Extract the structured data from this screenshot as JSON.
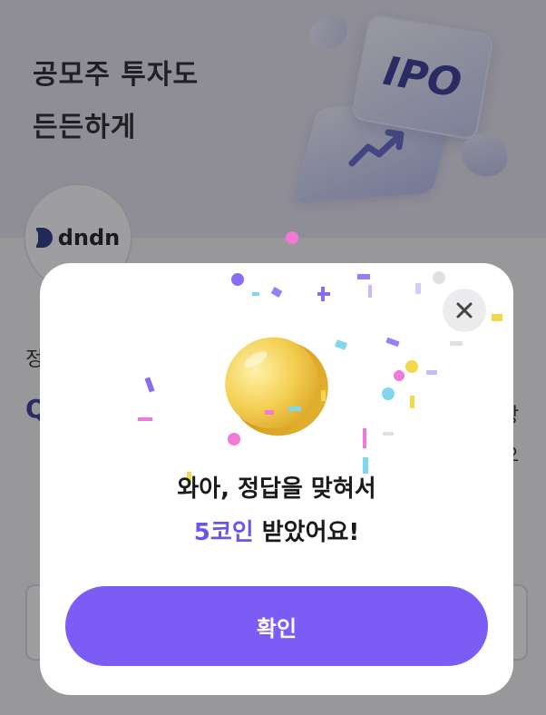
{
  "hero": {
    "title": "공모주 투자도\n든든하게",
    "card_label": "IPO"
  },
  "logo": {
    "text": "dndn"
  },
  "background_fragments": {
    "left_char": "정",
    "q_char": "Q",
    "right_char_1": "상",
    "right_char_2": "으"
  },
  "modal": {
    "message_line1": "와아, 정답을 맞혀서",
    "reward_amount": "5코인",
    "message_line2_rest": " 받았어요!",
    "confirm_label": "확인"
  },
  "colors": {
    "accent": "#7b5cf5",
    "reward_text": "#6a55e8",
    "hero_bg": "#e4e2ef"
  },
  "icons": {
    "close": "close-icon",
    "coin": "gold-coin-icon"
  }
}
